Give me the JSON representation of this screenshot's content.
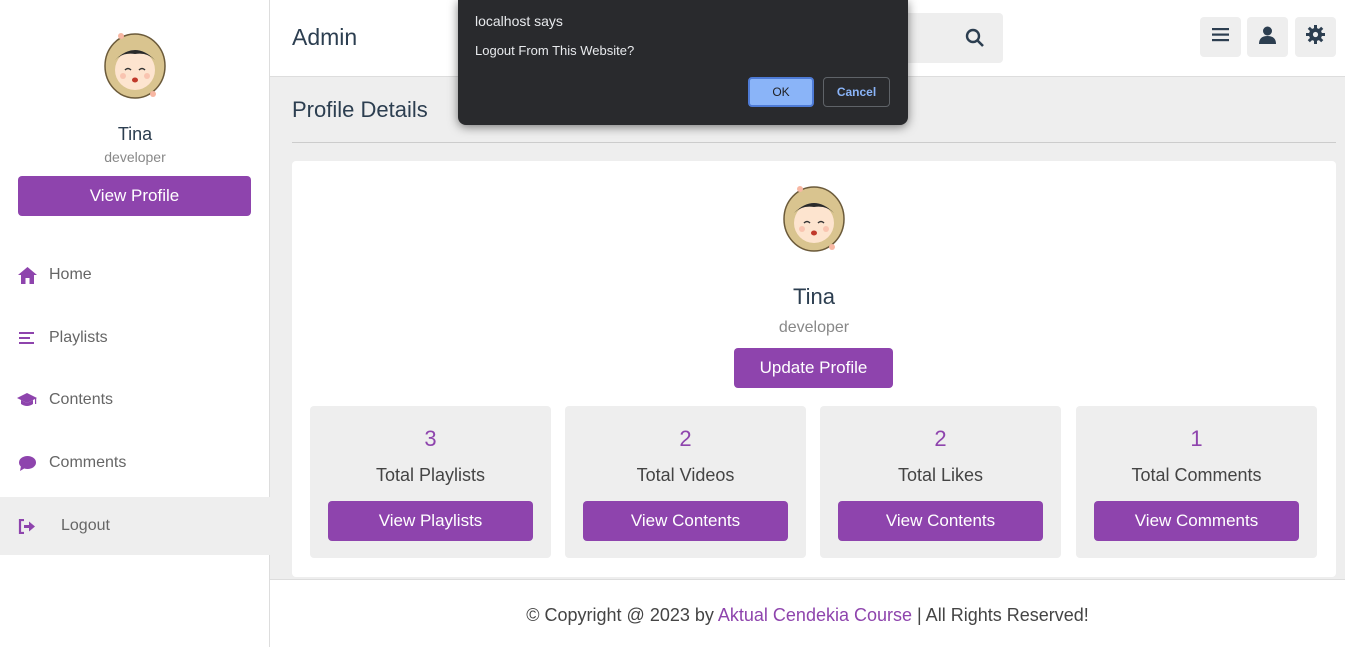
{
  "sidebar": {
    "name": "Tina",
    "role": "developer",
    "view_profile_label": "View Profile",
    "nav": [
      {
        "label": "Home",
        "icon": "home-icon"
      },
      {
        "label": "Playlists",
        "icon": "bars-icon"
      },
      {
        "label": "Contents",
        "icon": "graduation-cap-icon"
      },
      {
        "label": "Comments",
        "icon": "comment-icon"
      },
      {
        "label": "Logout",
        "icon": "logout-icon",
        "active": true
      }
    ]
  },
  "header": {
    "logo": "Admin",
    "buttons": [
      "menu-icon",
      "user-icon",
      "gear-icon"
    ]
  },
  "main": {
    "heading": "Profile Details",
    "profile": {
      "name": "Tina",
      "role": "developer",
      "update_label": "Update Profile"
    },
    "stats": [
      {
        "value": "3",
        "label": "Total Playlists",
        "button": "View Playlists"
      },
      {
        "value": "2",
        "label": "Total Videos",
        "button": "View Contents"
      },
      {
        "value": "2",
        "label": "Total Likes",
        "button": "View Contents"
      },
      {
        "value": "1",
        "label": "Total Comments",
        "button": "View Comments"
      }
    ]
  },
  "footer": {
    "prefix": "© Copyright @ 2023 by ",
    "link": "Aktual Cendekia Course",
    "suffix": " | All Rights Reserved!"
  },
  "dialog": {
    "title": "localhost says",
    "message": "Logout From This Website?",
    "ok_label": "OK",
    "cancel_label": "Cancel"
  },
  "colors": {
    "accent": "#8e44ad",
    "background": "#eeeeee",
    "dialog_bg": "#292a2d",
    "dialog_ok": "#8ab4f8"
  }
}
